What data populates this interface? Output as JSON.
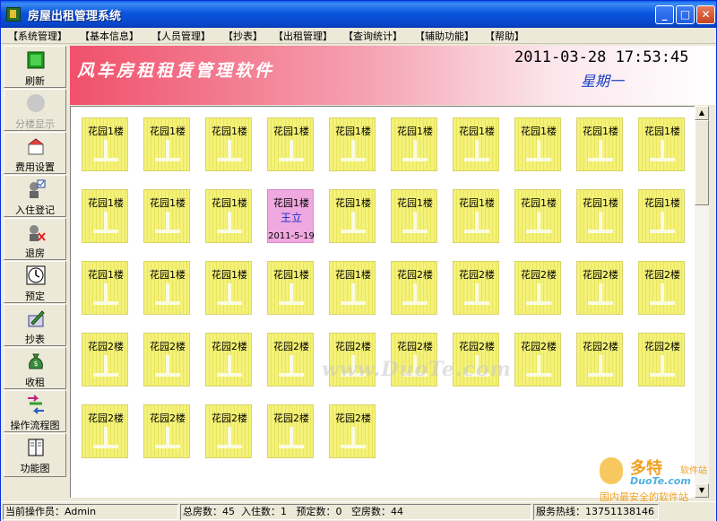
{
  "window": {
    "title": "房屋出租管理系统"
  },
  "menu": [
    "【系统管理】",
    "【基本信息】",
    "【人员管理】",
    "【抄表】",
    "【出租管理】",
    "【查询统计】",
    "【辅助功能】",
    "【帮助】"
  ],
  "toolbar": [
    {
      "label": "刷新",
      "icon": "refresh-icon"
    },
    {
      "label": "分楼显示",
      "icon": "building-filter-icon",
      "disabled": true
    },
    {
      "label": "费用设置",
      "icon": "fee-settings-icon"
    },
    {
      "label": "入住登记",
      "icon": "checkin-icon"
    },
    {
      "label": "退房",
      "icon": "checkout-icon"
    },
    {
      "label": "预定",
      "icon": "clock-icon"
    },
    {
      "label": "抄表",
      "icon": "pen-icon"
    },
    {
      "label": "收租",
      "icon": "money-bag-icon"
    },
    {
      "label": "操作流程图",
      "icon": "flowchart-icon"
    },
    {
      "label": "功能图",
      "icon": "book-icon"
    }
  ],
  "banner": {
    "title": "风车房租租赁管理软件",
    "datetime": "2011-03-28 17:53:45",
    "weekday": "星期一"
  },
  "rooms": [
    [
      "花园1楼",
      "花园1楼",
      "花园1楼",
      "花园1楼",
      "花园1楼",
      "花园1楼",
      "花园1楼",
      "花园1楼",
      "花园1楼",
      "花园1楼"
    ],
    [
      "花园1楼",
      "花园1楼",
      "花园1楼",
      "花园1楼",
      "花园1楼",
      "花园1楼",
      "花园1楼",
      "花园1楼",
      "花园1楼",
      "花园1楼"
    ],
    [
      "花园1楼",
      "花园1楼",
      "花园1楼",
      "花园1楼",
      "花园1楼",
      "花园2楼",
      "花园2楼",
      "花园2楼",
      "花园2楼",
      "花园2楼"
    ],
    [
      "花园2楼",
      "花园2楼",
      "花园2楼",
      "花园2楼",
      "花园2楼",
      "花园2楼",
      "花园2楼",
      "花园2楼",
      "花园2楼",
      "花园2楼"
    ],
    [
      "花园2楼",
      "花园2楼",
      "花园2楼",
      "花园2楼",
      "花园2楼"
    ]
  ],
  "occupied_room": {
    "name": "花园1楼",
    "tenant": "王立",
    "date": "2011-5-19"
  },
  "watermark": "www.DuoTe.com",
  "corner_logo": {
    "big": "多特",
    "small": "软件站",
    "url": "DuoTe.com",
    "slogan": "国内最安全的软件站"
  },
  "status": {
    "operator": "当前操作员：Admin",
    "counts": "总房数：45  入住数：1   预定数：0   空房数：44",
    "hotline": "服务热线：13751138146"
  },
  "colors": {
    "vacant": "#f4f27a",
    "occupied": "#f0a8e0",
    "banner": "#f0506a",
    "titlebar": "#0a55de"
  }
}
